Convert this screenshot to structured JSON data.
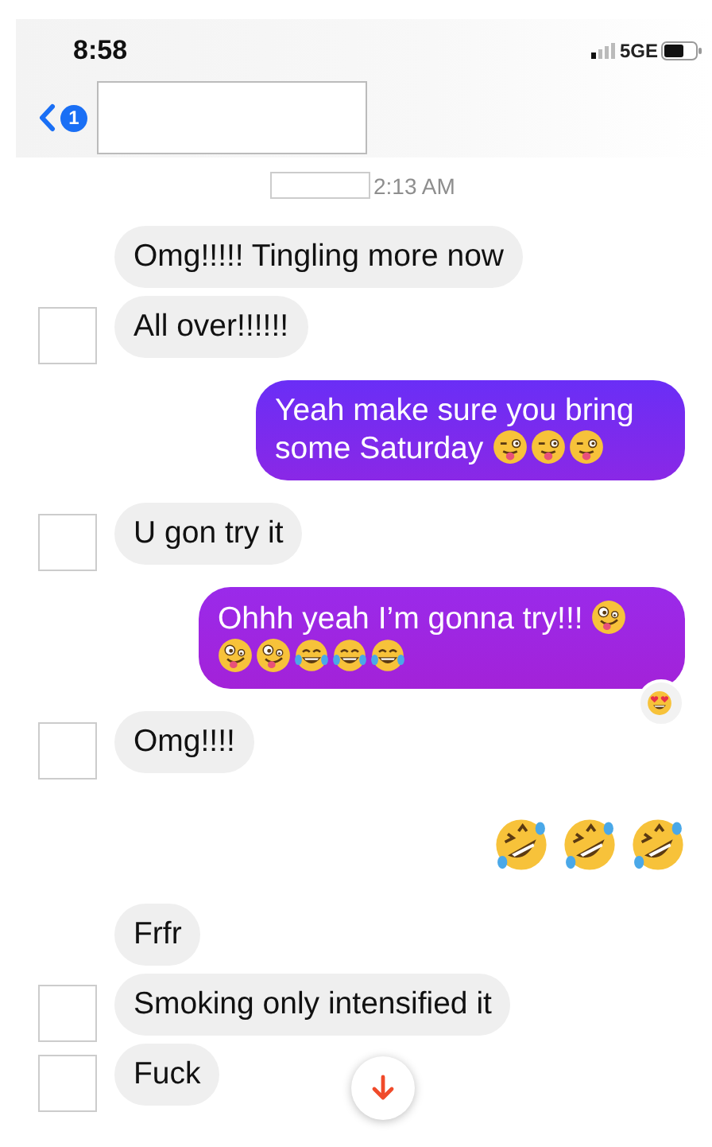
{
  "status_bar": {
    "time": "8:58",
    "network": "5GE"
  },
  "header": {
    "back_badge": "1"
  },
  "timestamp": {
    "time": "2:13 AM"
  },
  "messages": [
    {
      "outgoing": false,
      "text": "Omg!!!!! Tingling more now",
      "avatar": false
    },
    {
      "outgoing": false,
      "text": "All over!!!!!!",
      "avatar": true
    },
    {
      "outgoing": true,
      "text": "Yeah make sure you bring some Saturday",
      "emojis": [
        {
          "kind": "wink-tongue"
        },
        {
          "kind": "wink-tongue"
        },
        {
          "kind": "wink-tongue"
        }
      ]
    },
    {
      "outgoing": false,
      "text": "U gon try it",
      "avatar": true
    },
    {
      "outgoing": true,
      "text": "Ohhh yeah I’m gonna try!!!",
      "emojis": [
        {
          "kind": "zany"
        },
        {
          "kind": "zany"
        },
        {
          "kind": "zany"
        },
        {
          "kind": "tears-joy"
        },
        {
          "kind": "tears-joy"
        },
        {
          "kind": "tears-joy"
        }
      ],
      "reaction": {
        "kind": "heart-eyes"
      }
    },
    {
      "outgoing": false,
      "text": "Omg!!!!",
      "avatar": true
    },
    {
      "outgoing": true,
      "emojis": [
        {
          "kind": "rofl"
        },
        {
          "kind": "rofl"
        },
        {
          "kind": "rofl"
        }
      ]
    },
    {
      "outgoing": false,
      "text": "Frfr",
      "avatar": false
    },
    {
      "outgoing": false,
      "text": "Smoking only intensified it",
      "avatar": true
    },
    {
      "outgoing": false,
      "text": "Fuck",
      "avatar": true
    }
  ]
}
